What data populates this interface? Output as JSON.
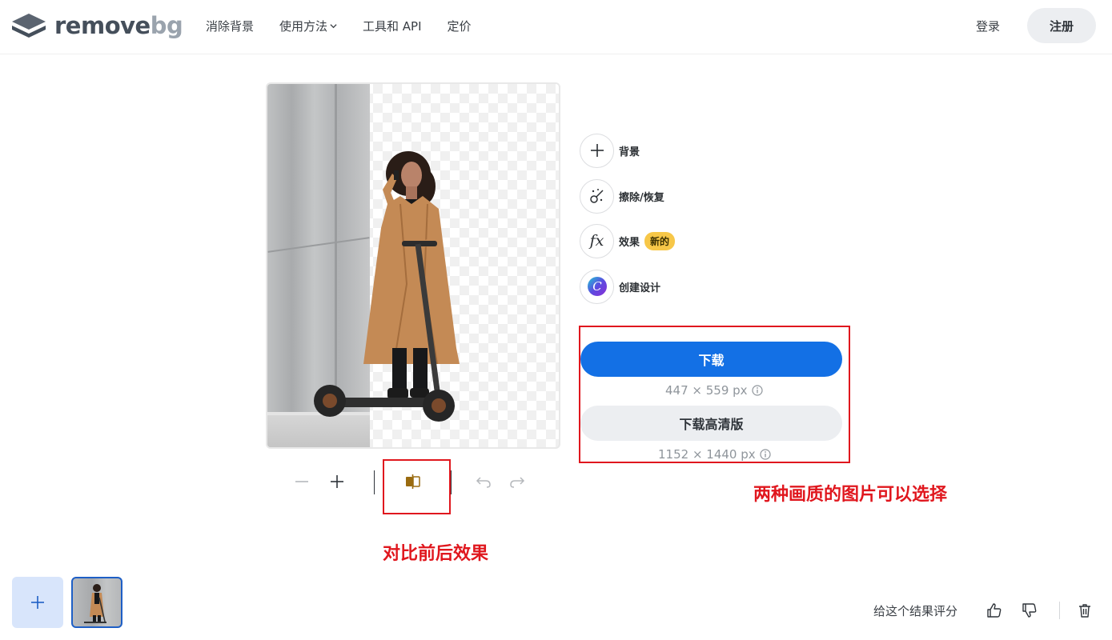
{
  "header": {
    "logo": {
      "word_main": "remove",
      "word_accent": "bg"
    },
    "nav": [
      {
        "label": "消除背景"
      },
      {
        "label": "使用方法"
      },
      {
        "label": "工具和 API"
      },
      {
        "label": "定价"
      }
    ],
    "login_label": "登录",
    "signup_label": "注册"
  },
  "actions": [
    {
      "label": "背景",
      "icon": "plus-icon"
    },
    {
      "label": "擦除/恢复",
      "icon": "magic-brush-icon"
    },
    {
      "label": "效果",
      "icon": "fx-icon",
      "badge": "新的"
    },
    {
      "label": "创建设计",
      "icon": "canva-icon"
    }
  ],
  "fx_glyph": "fx",
  "canva_glyph": "C",
  "download": {
    "label": "下载",
    "size": "447 × 559 px"
  },
  "download_hd": {
    "label": "下载高清版",
    "size": "1152 × 1440 px"
  },
  "annotations": {
    "quality": "两种画质的图片可以选择",
    "compare": "对比前后效果"
  },
  "footer": {
    "rate_label": "给这个结果评分"
  },
  "colors": {
    "primary": "#1370e5",
    "annotation": "#e0171e",
    "badge": "#f7c748",
    "coat": "#c48a55"
  }
}
